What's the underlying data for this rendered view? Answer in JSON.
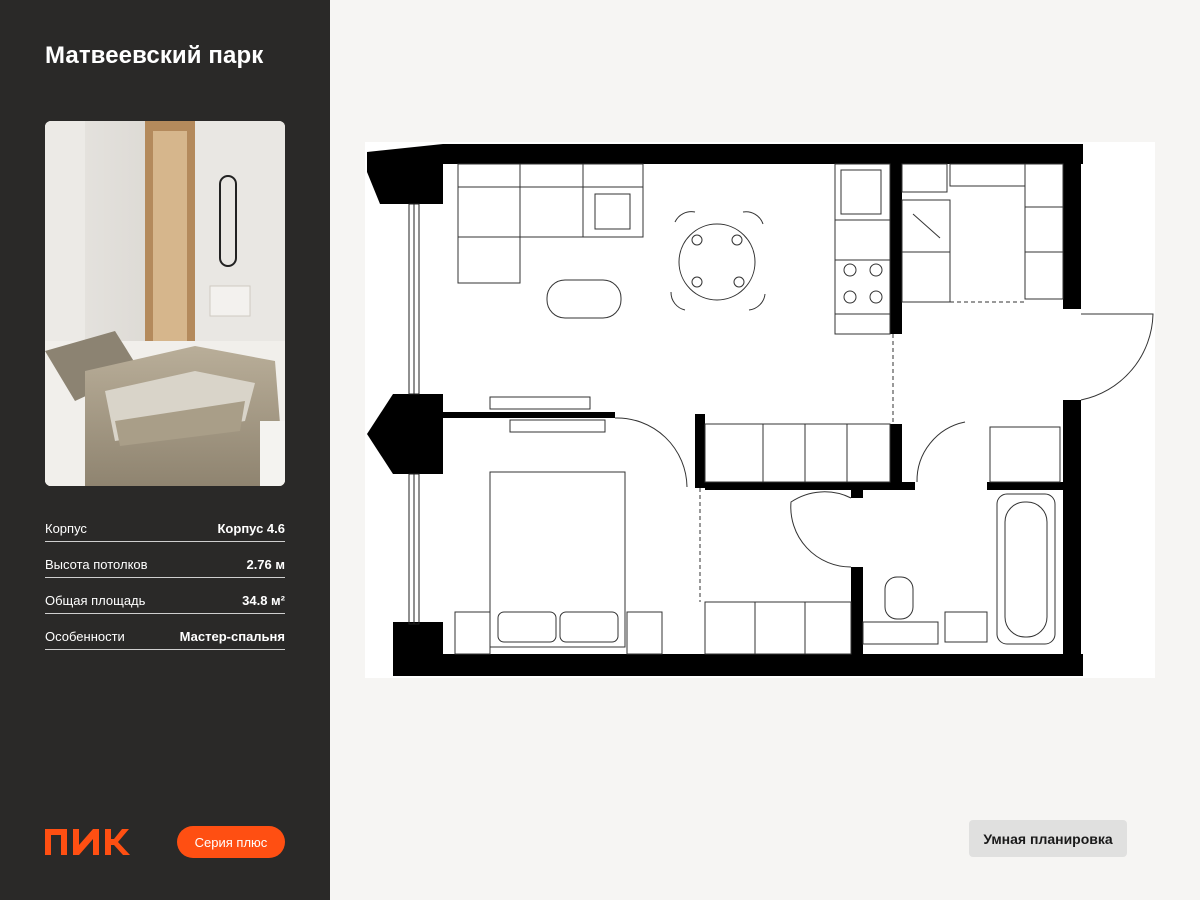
{
  "project": {
    "title": "Матвеевский парк"
  },
  "properties": [
    {
      "label": "Корпус",
      "value": "Корпус 4.6"
    },
    {
      "label": "Высота потолков",
      "value": "2.76 м"
    },
    {
      "label": "Общая площадь",
      "value": "34.8 м²"
    },
    {
      "label": "Особенности",
      "value": "Мастер-спальня"
    }
  ],
  "brand": {
    "logo_text": "ПИК",
    "series_label": "Серия плюс",
    "accent_color": "#ff4f12"
  },
  "plan": {
    "smart_label": "Умная планировка"
  },
  "colors": {
    "sidebar_bg": "#2a2928",
    "page_bg": "#f6f5f3",
    "wall": "#000000"
  }
}
